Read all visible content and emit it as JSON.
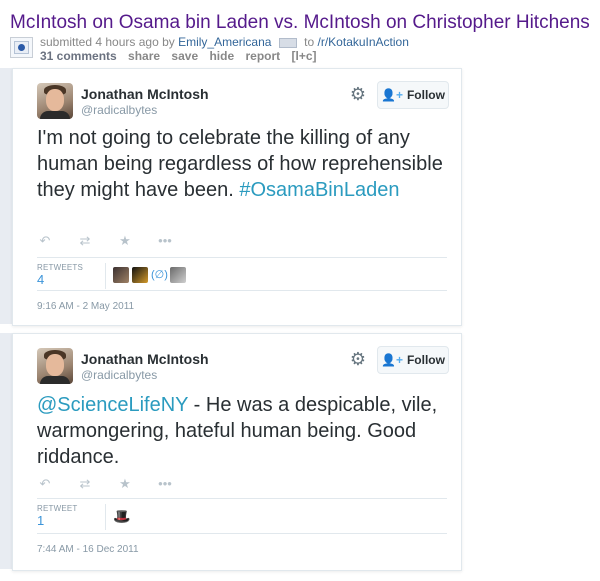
{
  "post": {
    "title": "McIntosh on Osama bin Laden vs. McIntosh on Christopher Hitchens",
    "tagline_prefix": "submitted 4 hours ago by",
    "author": "Emily_Americana",
    "to_text": "to",
    "subreddit": "/r/KotakuInAction",
    "buttons": {
      "comments": "31 comments",
      "share": "share",
      "save": "save",
      "hide": "hide",
      "report": "report",
      "context": "[l+c]"
    }
  },
  "tweets": [
    {
      "name": "Jonathan McIntosh",
      "handle": "@radicalbytes",
      "follow_label": "Follow",
      "text_plain": "I'm not going to celebrate the killing of any human being regardless of how reprehensible they might have been.",
      "hashtag": "#OsamaBinLaden",
      "retweets_label": "RETWEETS",
      "retweets_count": "4",
      "timestamp": "9:16 AM - 2 May 2011",
      "retweeter_icons": [
        "avatar",
        "avatar",
        "null-set-avatar",
        "avatar"
      ]
    },
    {
      "name": "Jonathan McIntosh",
      "handle": "@radicalbytes",
      "follow_label": "Follow",
      "mention": "@ScienceLifeNY",
      "text_plain": " - He was a despicable, vile, warmongering, hateful human being. Good riddance.",
      "retweets_label": "RETWEET",
      "retweets_count": "1",
      "timestamp": "7:44 AM - 16 Dec 2011",
      "retweeter_icons": [
        "hat-avatar"
      ]
    }
  ],
  "icons": {
    "reply": "↶",
    "retweet": "⇄",
    "favorite": "★",
    "more": "•••",
    "gear": "⚙",
    "follow_person": "👤+",
    "null_set": "(∅)",
    "hat": "🎩"
  },
  "colors": {
    "title": "#551a8b",
    "link": "#336699",
    "hashtag": "#2b9bbf",
    "count": "#3b94d9"
  }
}
